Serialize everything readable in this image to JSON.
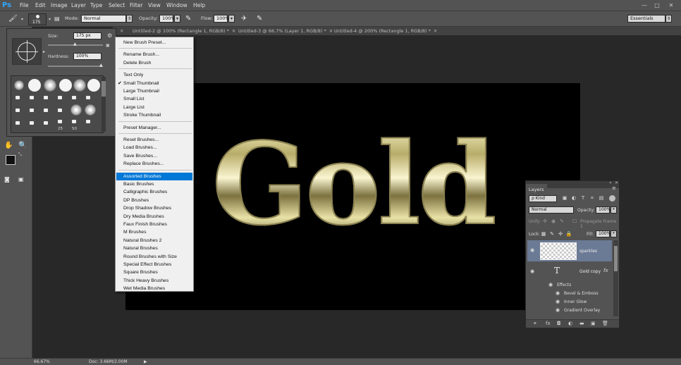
{
  "app": {
    "logo": "Ps",
    "menu": [
      "File",
      "Edit",
      "Image",
      "Layer",
      "Type",
      "Select",
      "Filter",
      "View",
      "Window",
      "Help"
    ],
    "window_controls": {
      "minimize": "—",
      "maximize": "□",
      "close": "✕"
    }
  },
  "options_bar": {
    "brush_size": "175",
    "mode_label": "Mode:",
    "mode_value": "Normal",
    "opacity_label": "Opacity:",
    "opacity_value": "100%",
    "flow_label": "Flow:",
    "flow_value": "100%",
    "workspace": "Essentials"
  },
  "tabs": [
    {
      "label": "Untitled-2 @ 100% (Rectangle 1, RGB/8) *"
    },
    {
      "label": "Untitled-3 @ 66.7% (Layer 1, RGB/8) *"
    },
    {
      "label": "Untitled-4 @ 200% (Rectangle 1, RGB/8) *"
    }
  ],
  "brush_panel": {
    "size_label": "Size:",
    "size_value": "175 px",
    "hardness_label": "Hardness:",
    "hardness_value": "100%",
    "size_level": 0.5,
    "hardness_level": 1.0,
    "thumb_numbers": [
      "25",
      "50"
    ]
  },
  "dropdown": {
    "groups": [
      [
        "New Brush Preset..."
      ],
      [
        "Rename Brush...",
        "Delete Brush"
      ],
      [
        "Text Only",
        "Small Thumbnail",
        "Large Thumbnail",
        "Small List",
        "Large List",
        "Stroke Thumbnail"
      ],
      [
        "Preset Manager..."
      ],
      [
        "Reset Brushes...",
        "Load Brushes...",
        "Save Brushes...",
        "Replace Brushes..."
      ],
      [
        "Assorted Brushes",
        "Basic Brushes",
        "Calligraphic Brushes",
        "DP Brushes",
        "Drop Shadow Brushes",
        "Dry Media Brushes",
        "Faux Finish Brushes",
        "M Brushes",
        "Natural Brushes 2",
        "Natural Brushes",
        "Round Brushes with Size",
        "Special Effect Brushes",
        "Square Brushes",
        "Thick Heavy Brushes",
        "Wet Media Brushes"
      ]
    ],
    "checked": "Small Thumbnail",
    "highlighted": "Assorted Brushes"
  },
  "canvas": {
    "text": "Gold"
  },
  "layers": {
    "title": "Layers",
    "filter_kind": "ρ Kind",
    "blend_mode": "Normal",
    "opacity_label": "Opacity:",
    "opacity_value": "100%",
    "unify_label": "Unify:",
    "propagate_label": "Propagate Frame 1",
    "lock_label": "Lock:",
    "fill_label": "Fill:",
    "fill_value": "100%",
    "items": [
      {
        "name": "sparkles"
      },
      {
        "name": "Gold copy",
        "type_glyph": "T",
        "fx": "fx"
      }
    ],
    "effects_label": "Effects",
    "effects": [
      "Bevel & Emboss",
      "Inner Glow",
      "Gradient Overlay"
    ]
  },
  "status": {
    "zoom": "66.67%",
    "doc": "Doc: 3.66M/2.00M"
  },
  "colors": {
    "ui_panel": "#535353",
    "ui_dark": "#282828",
    "highlight": "#0078d7",
    "selected_layer": "#6b7a95",
    "ps_blue": "#31a8ff",
    "gold": "#e9e2a6"
  }
}
